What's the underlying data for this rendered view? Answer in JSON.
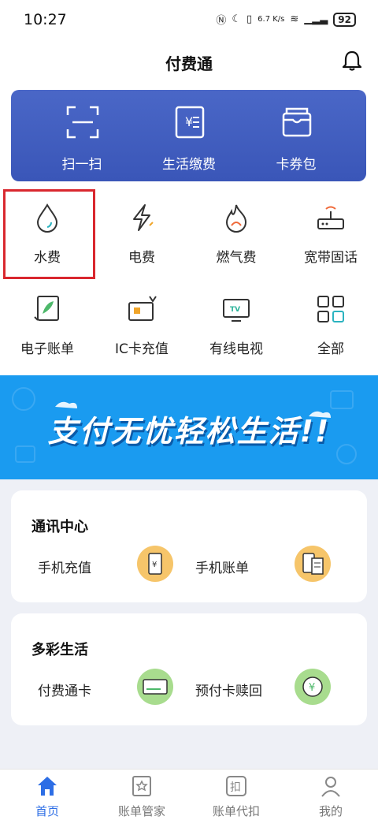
{
  "status_bar": {
    "time": "10:27",
    "network_speed": "6.7 K/s",
    "battery": "92"
  },
  "header": {
    "title": "付费通"
  },
  "quick_actions": [
    {
      "label": "扫一扫",
      "icon": "scan-icon"
    },
    {
      "label": "生活缴费",
      "icon": "bill-icon"
    },
    {
      "label": "卡券包",
      "icon": "wallet-icon"
    }
  ],
  "services": [
    {
      "label": "水费",
      "icon": "water-drop-icon",
      "highlighted": true
    },
    {
      "label": "电费",
      "icon": "lightning-icon"
    },
    {
      "label": "燃气费",
      "icon": "flame-icon"
    },
    {
      "label": "宽带固话",
      "icon": "router-icon"
    },
    {
      "label": "电子账单",
      "icon": "e-bill-icon"
    },
    {
      "label": "IC卡充值",
      "icon": "ic-card-icon"
    },
    {
      "label": "有线电视",
      "icon": "tv-icon"
    },
    {
      "label": "全部",
      "icon": "grid-icon"
    }
  ],
  "banner": {
    "text": "支付无忧轻松生活!!",
    "color": "#1a9bf0"
  },
  "telecom_center": {
    "title": "通讯中心",
    "items": [
      {
        "label": "手机充值",
        "icon": "phone-topup-icon"
      },
      {
        "label": "手机账单",
        "icon": "phone-bill-icon"
      }
    ]
  },
  "colorful_life": {
    "title": "多彩生活",
    "items": [
      {
        "label": "付费通卡",
        "icon": "card-icon"
      },
      {
        "label": "预付卡赎回",
        "icon": "redeem-icon"
      }
    ]
  },
  "tabbar": [
    {
      "label": "首页",
      "icon": "home-icon",
      "active": true
    },
    {
      "label": "账单管家",
      "icon": "bill-manager-icon"
    },
    {
      "label": "账单代扣",
      "icon": "auto-debit-icon"
    },
    {
      "label": "我的",
      "icon": "profile-icon"
    }
  ],
  "colors": {
    "accent": "#2d6ee5",
    "card_blue": "#4a67c7",
    "highlight_border": "#d9272e"
  }
}
